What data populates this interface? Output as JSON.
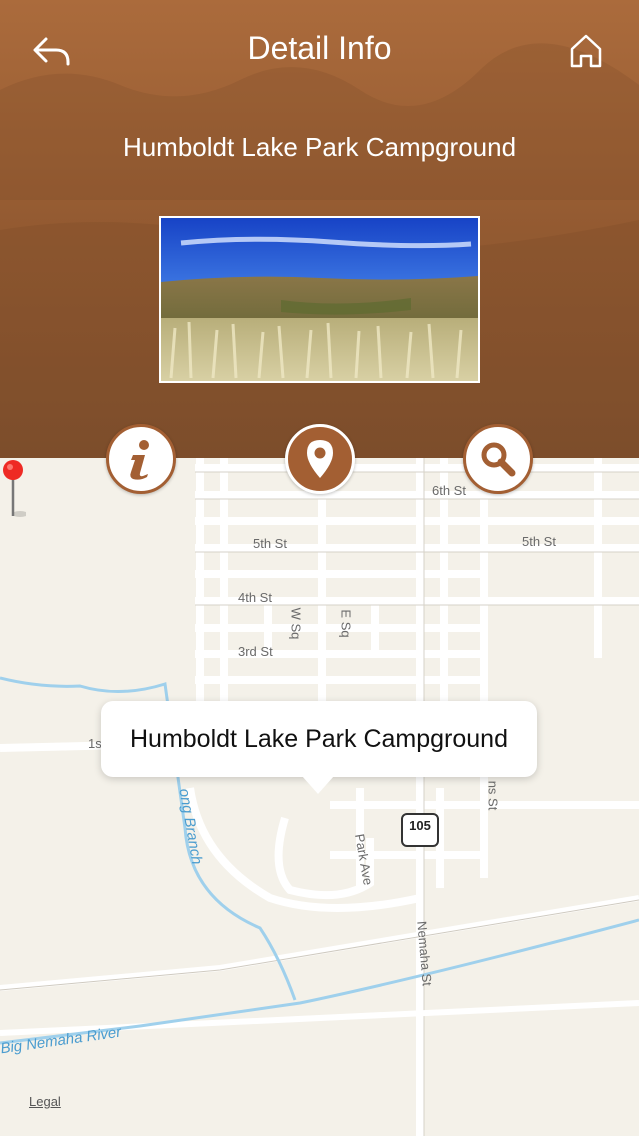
{
  "nav": {
    "title": "Detail Info",
    "back_icon": "back-arrow-icon",
    "home_icon": "home-icon"
  },
  "place": {
    "name": "Humboldt Lake Park Campground",
    "photo_alt": "prairie-landscape"
  },
  "actions": [
    {
      "id": "info",
      "icon": "info-icon",
      "active": false
    },
    {
      "id": "map",
      "icon": "map-pin-icon",
      "active": true
    },
    {
      "id": "search",
      "icon": "search-icon",
      "active": false
    }
  ],
  "map": {
    "callout": "Humboldt Lake Park Campground",
    "streets": [
      "6th St",
      "5th St",
      "5th St",
      "4th St",
      "3rd St",
      "1s",
      "W Sq",
      "E Sq",
      "Park Ave",
      "Nemaha St",
      "ns St"
    ],
    "water": [
      "ong Branch",
      "Big Nemaha River"
    ],
    "route_shield": "105",
    "legal": "Legal"
  },
  "colors": {
    "accent": "#a35f33",
    "header": "#9a5d32",
    "map_bg": "#f4f1e9",
    "water": "#9fd0ec"
  }
}
